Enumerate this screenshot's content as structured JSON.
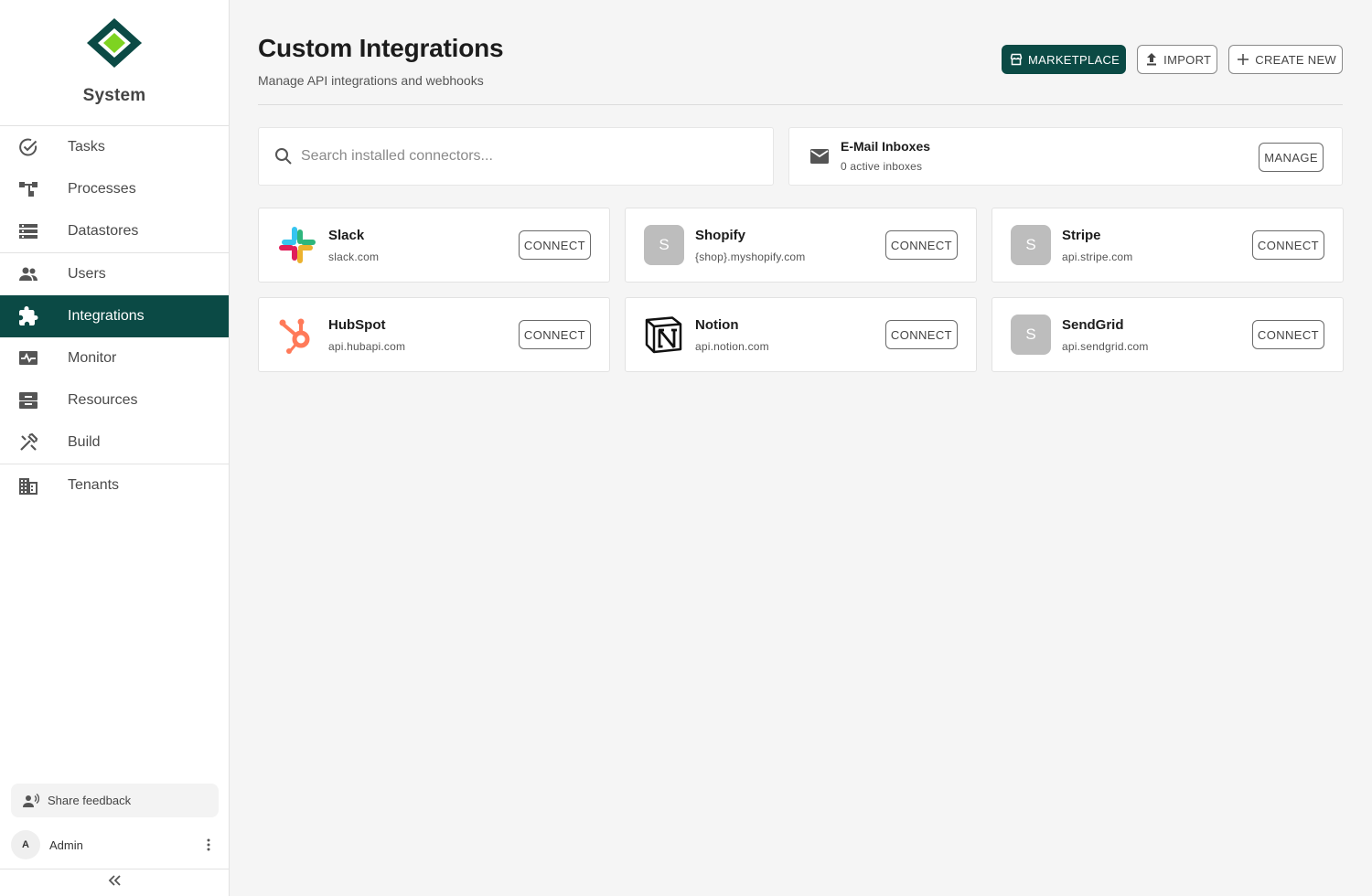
{
  "app": {
    "name": "System",
    "brand_color": "#0b4a45",
    "logo_colors": [
      "#0b4a45",
      "#7ed321"
    ]
  },
  "sidebar": {
    "groups": [
      [
        {
          "label": "Tasks",
          "icon": "check-circle-icon"
        },
        {
          "label": "Processes",
          "icon": "process-tree-icon"
        },
        {
          "label": "Datastores",
          "icon": "list-rows-icon"
        }
      ],
      [
        {
          "label": "Users",
          "icon": "users-icon"
        },
        {
          "label": "Integrations",
          "icon": "puzzle-icon",
          "active": true
        },
        {
          "label": "Monitor",
          "icon": "monitor-pulse-icon"
        },
        {
          "label": "Resources",
          "icon": "tray-icon"
        },
        {
          "label": "Build",
          "icon": "tools-icon"
        }
      ],
      [
        {
          "label": "Tenants",
          "icon": "building-icon"
        }
      ]
    ],
    "feedback_label": "Share feedback",
    "user": {
      "initial": "A",
      "name": "Admin"
    }
  },
  "header": {
    "title": "Custom Integrations",
    "subtitle": "Manage API integrations and webhooks",
    "actions": {
      "marketplace": "MARKETPLACE",
      "import": "IMPORT",
      "create": "CREATE NEW"
    }
  },
  "search": {
    "placeholder": "Search installed connectors...",
    "value": ""
  },
  "inboxes": {
    "title": "E-Mail Inboxes",
    "subtitle": "0 active inboxes",
    "button": "MANAGE"
  },
  "connectors": [
    {
      "name": "Slack",
      "host": "slack.com",
      "logo": "slack-logo",
      "button": "CONNECT"
    },
    {
      "name": "Shopify",
      "host": "{shop}.myshopify.com",
      "logo": "placeholder",
      "initial": "S",
      "button": "CONNECT"
    },
    {
      "name": "Stripe",
      "host": "api.stripe.com",
      "logo": "placeholder",
      "initial": "S",
      "button": "CONNECT"
    },
    {
      "name": "HubSpot",
      "host": "api.hubapi.com",
      "logo": "hubspot-logo",
      "button": "CONNECT"
    },
    {
      "name": "Notion",
      "host": "api.notion.com",
      "logo": "notion-logo",
      "button": "CONNECT"
    },
    {
      "name": "SendGrid",
      "host": "api.sendgrid.com",
      "logo": "placeholder",
      "initial": "S",
      "button": "CONNECT"
    }
  ]
}
